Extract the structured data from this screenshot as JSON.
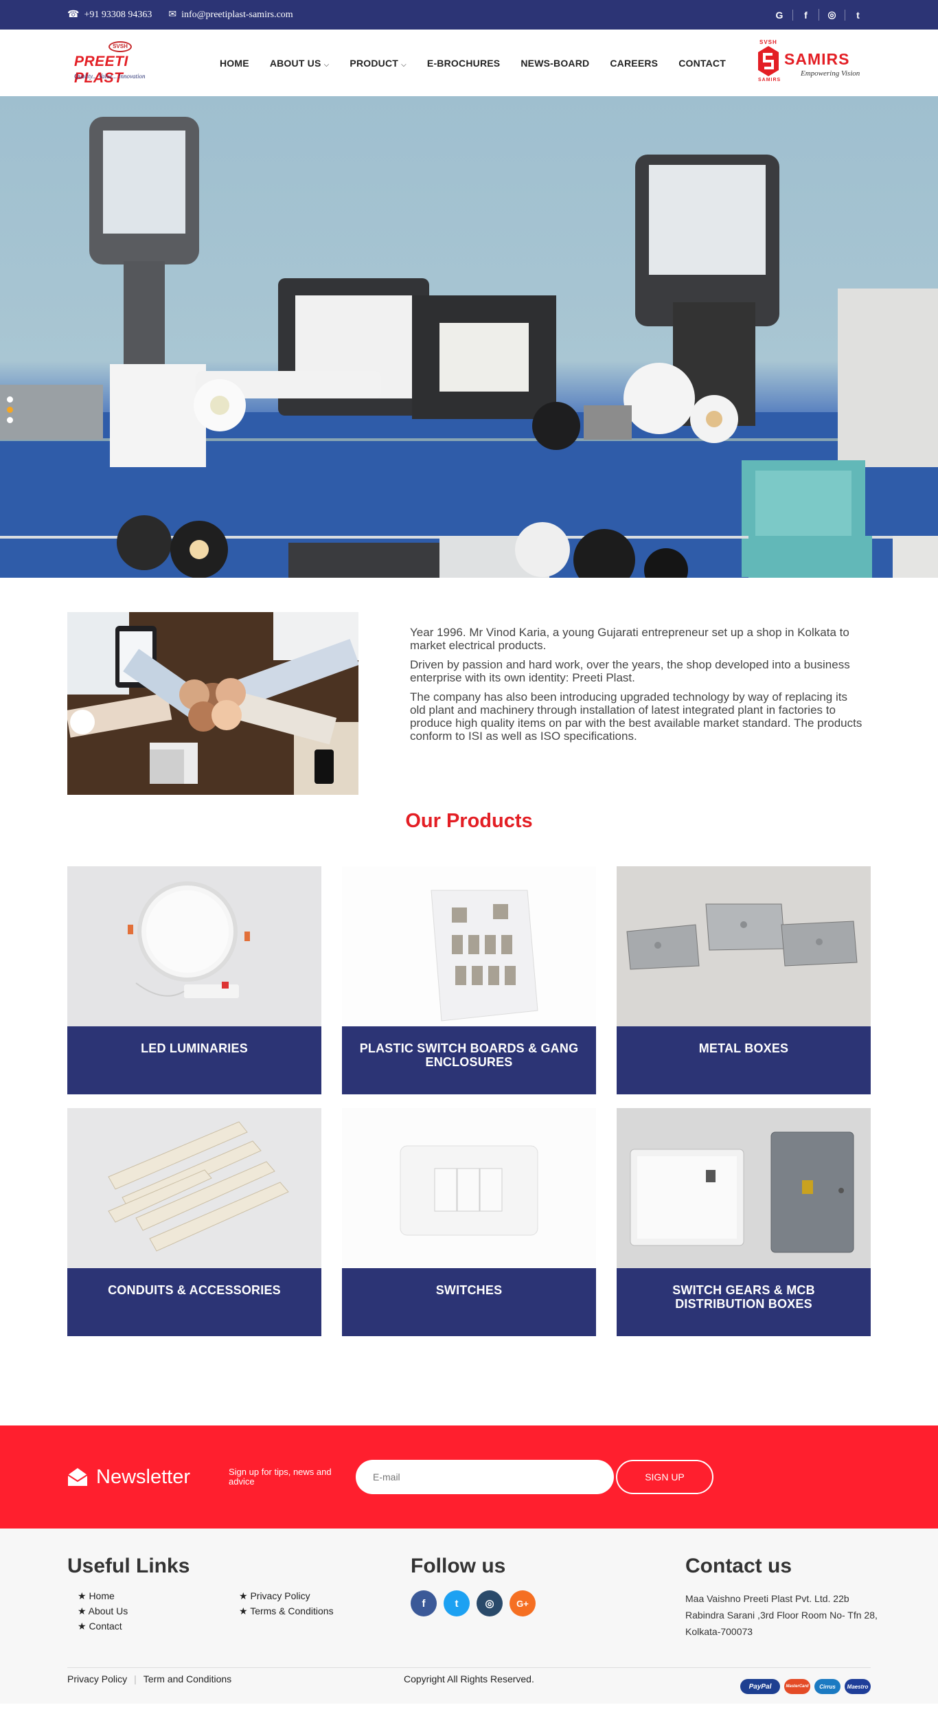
{
  "topbar": {
    "phone": "+91 93308 94363",
    "email": "info@preetiplast-samirs.com",
    "social": [
      "G",
      "f",
      "◎",
      "t"
    ]
  },
  "logo": {
    "badge": "SVSH",
    "name": "PREETI PLAST",
    "tagline": "Quality... Value... Innovation"
  },
  "nav": {
    "items": [
      "HOME",
      "ABOUT US",
      "PRODUCT",
      "E-BROCHURES",
      "NEWS-BOARD",
      "CAREERS",
      "CONTACT"
    ]
  },
  "partner_logo": {
    "top": "SVSH",
    "name": "SAMIRS",
    "tagline": "Empowering Vision",
    "bottom": "SAMIRS"
  },
  "hero": {
    "slides": 2,
    "active_slide": 1,
    "colors": {
      "sky": "#a9c6d3",
      "table": "#2a56a6"
    }
  },
  "about": {
    "paragraphs": [
      "Year 1996. Mr Vinod Karia, a young Gujarati entrepreneur set up a shop in Kolkata to market electrical products.",
      "Driven by passion and hard work, over the years, the shop developed into a business enterprise with its own identity: Preeti Plast.",
      "The company has also been introducing upgraded technology by way of replacing its old plant and machinery through installation of latest integrated plant in factories to produce high quality items on par with the best available market standard. The products conform to ISI as well as ISO specifications."
    ]
  },
  "products": {
    "title": "Our Products",
    "items": [
      {
        "label": "LED LUMINARIES"
      },
      {
        "label": "PLASTIC SWITCH BOARDS & GANG ENCLOSURES"
      },
      {
        "label": "METAL BOXES"
      },
      {
        "label": "CONDUITS & ACCESSORIES"
      },
      {
        "label": "SWITCHES"
      },
      {
        "label": "SWITCH GEARS & MCB DISTRIBUTION BOXES"
      }
    ]
  },
  "newsletter": {
    "title": "Newsletter",
    "subtitle": "Sign up for tips, news and advice",
    "email_placeholder": "E-mail",
    "button": "SIGN UP"
  },
  "footer": {
    "useful_links_title": "Useful Links",
    "links": [
      "★ Home",
      "★ Privacy Policy",
      "★ About Us",
      "★ Terms & Conditions",
      "★ Contact"
    ],
    "follow_title": "Follow us",
    "follow_icons": [
      "f",
      "t",
      "◎",
      "G+"
    ],
    "contact_title": "Contact us",
    "contact_address": "Maa Vaishno Preeti Plast Pvt. Ltd. 22b Rabindra Sarani ,3rd Floor Room No- Tfn 28, Kolkata-700073",
    "bottom_links": [
      "Privacy Policy",
      "Term and Conditions"
    ],
    "copyright": "Copyright All Rights Reserved.",
    "payments": [
      "PayPal",
      "MasterCard",
      "Cirrus",
      "Maestro"
    ]
  },
  "colors": {
    "navy": "#2c3475",
    "red": "#e31e24",
    "newsletter_red": "#ff1f2e"
  }
}
